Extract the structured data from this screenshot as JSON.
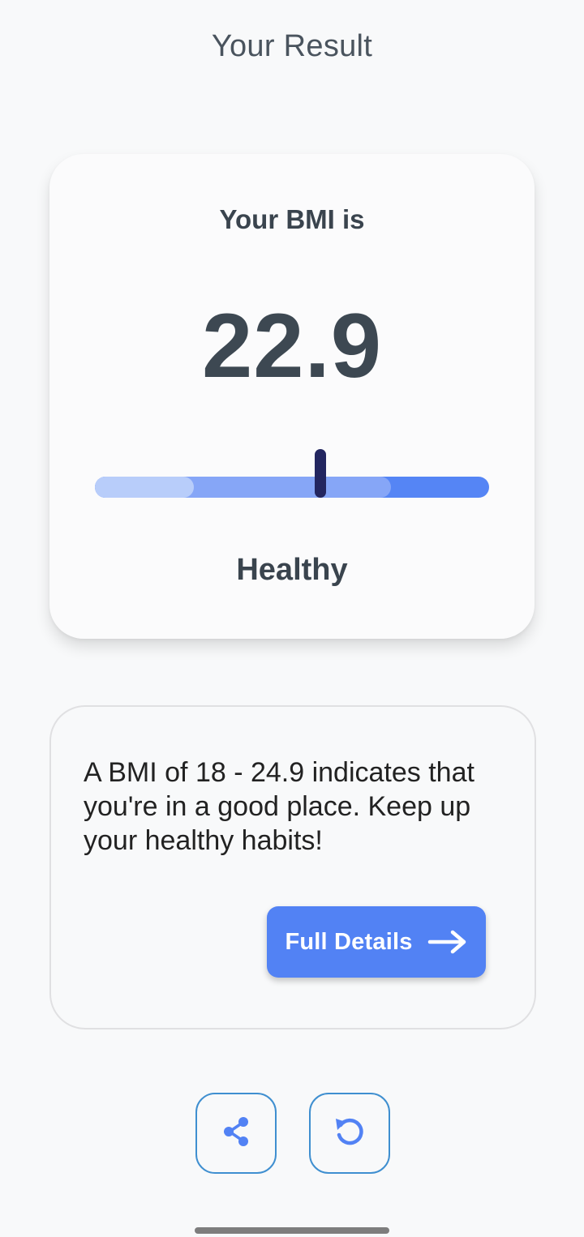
{
  "header": {
    "title": "Your Result"
  },
  "result_card": {
    "label": "Your BMI is",
    "value": "22.9",
    "category": "Healthy",
    "scale": {
      "min": 0,
      "max": 40,
      "value": 22.9,
      "segments": [
        {
          "name": "underweight",
          "upto": 10,
          "color": "#b8cdfa"
        },
        {
          "name": "normal",
          "upto": 30,
          "color": "#86a6f7"
        },
        {
          "name": "overweight",
          "upto": 40,
          "color": "#5585f5"
        }
      ],
      "indicator_color": "#232660"
    }
  },
  "info_card": {
    "text": "A BMI of 18 - 24.9 indicates that you're in a good place. Keep up your healthy habits!",
    "button_label": "Full Details",
    "button_icon": "arrow-right-icon"
  },
  "actions": {
    "share_icon": "share-icon",
    "reset_icon": "reset-icon"
  },
  "colors": {
    "accent": "#5282f4",
    "outline": "#3f8fd0",
    "background": "#f8f9fa"
  }
}
